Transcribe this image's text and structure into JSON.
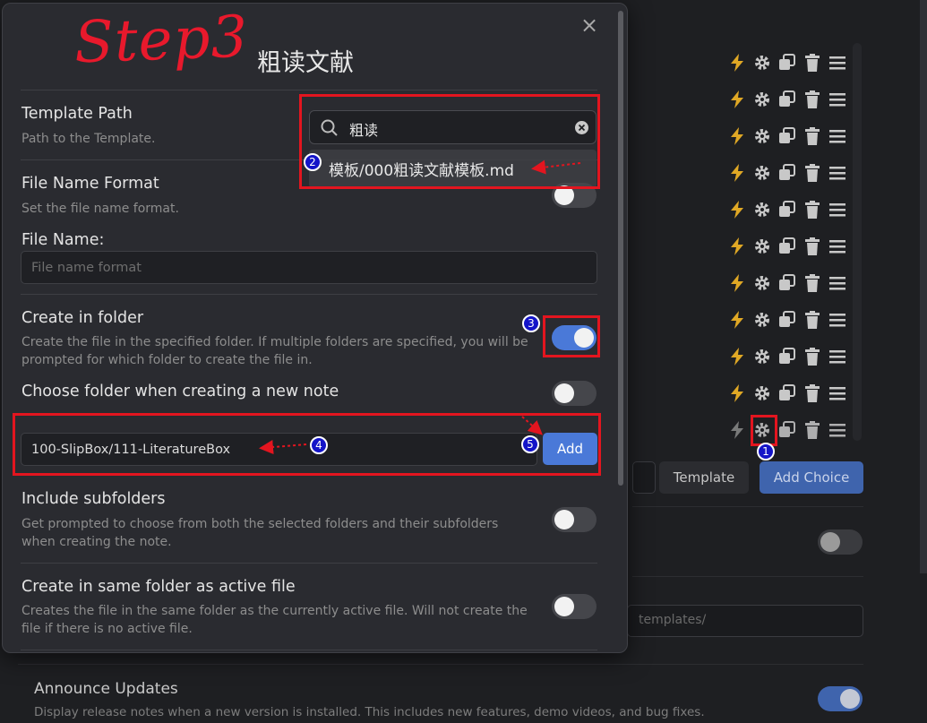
{
  "background": {
    "template_button": "Template",
    "add_choice_button": "Add Choice",
    "templates_folder_value": "templates/",
    "announce_updates": {
      "title": "Announce Updates",
      "desc": "Display release notes when a new version is installed. This includes new features, demo videos, and bug fixes."
    },
    "choice_rows": 11
  },
  "annotation": {
    "step_label": "Step3",
    "markers": [
      "1",
      "2",
      "3",
      "4",
      "5"
    ]
  },
  "modal": {
    "title": "粗读文献",
    "close_icon": "×",
    "template_path": {
      "title": "Template Path",
      "desc": "Path to the Template.",
      "search_value": "粗读",
      "suggestion": "模板/000粗读文献模板.md"
    },
    "file_name_format": {
      "title": "File Name Format",
      "desc": "Set the file name format.",
      "enabled": false
    },
    "file_name": {
      "label": "File Name:",
      "placeholder": "File name format"
    },
    "create_in_folder": {
      "title": "Create in folder",
      "desc": "Create the file in the specified folder. If multiple folders are specified, you will be prompted for which folder to create the file in.",
      "enabled": true
    },
    "choose_folder": {
      "title": "Choose folder when creating a new note",
      "enabled": false
    },
    "folder_input": {
      "value": "100-SlipBox/111-LiteratureBox",
      "add_label": "Add"
    },
    "include_subfolders": {
      "title": "Include subfolders",
      "desc": "Get prompted to choose from both the selected folders and their subfolders when creating the note.",
      "enabled": false
    },
    "same_folder_active": {
      "title": "Create in same folder as active file",
      "desc": "Creates the file in the same folder as the currently active file. Will not create the file if there is no active file.",
      "enabled": false
    }
  },
  "colors": {
    "accent": "#4a79d8",
    "annotation_red": "#e3151f",
    "marker_blue": "#1414c8",
    "bolt_yellow": "#e0a825"
  }
}
